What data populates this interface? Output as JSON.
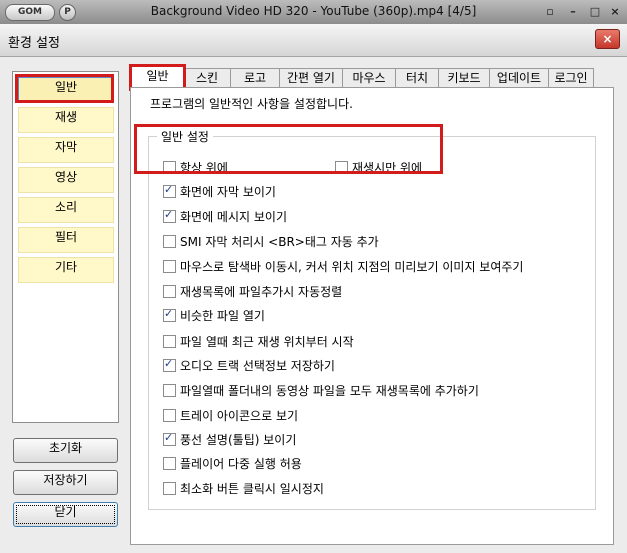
{
  "player": {
    "logo": "GOM",
    "p_badge": "P",
    "title": "Background Video HD 320 - YouTube (360p).mp4  [4/5]",
    "controls": {
      "pin": "▫",
      "minimize": "–",
      "maximize": "□",
      "close": "×"
    }
  },
  "dialog": {
    "title": "환경 설정",
    "close": "×"
  },
  "categories": [
    "일반",
    "재생",
    "자막",
    "영상",
    "소리",
    "필터",
    "기타"
  ],
  "selected_category": "일반",
  "side_buttons": {
    "reset": "초기화",
    "save": "저장하기",
    "close": "닫기"
  },
  "tabs": [
    "일반",
    "스킨",
    "로고",
    "간편 열기",
    "마우스",
    "터치",
    "키보드",
    "업데이트",
    "로그인"
  ],
  "active_tab": "일반",
  "description": "프로그램의 일반적인 사항을 설정합니다.",
  "group_label": "일반 설정",
  "options": [
    {
      "label": "항상 위에",
      "checked": false
    },
    {
      "label": "재생시만 위에",
      "checked": false
    },
    {
      "label": "화면에 자막 보이기",
      "checked": true
    },
    {
      "label": "화면에 메시지 보이기",
      "checked": true
    },
    {
      "label": "SMI 자막 처리시 <BR>태그 자동 추가",
      "checked": false
    },
    {
      "label": "마우스로 탐색바 이동시, 커서 위치 지점의 미리보기 이미지 보여주기",
      "checked": false
    },
    {
      "label": "재생목록에 파일추가시 자동정렬",
      "checked": false
    },
    {
      "label": "비슷한 파일 열기",
      "checked": true
    },
    {
      "label": "파일 열때 최근 재생 위치부터 시작",
      "checked": false
    },
    {
      "label": "오디오 트랙 선택정보 저장하기",
      "checked": true
    },
    {
      "label": "파일열때 폴더내의 동영상 파일을 모두 재생목록에 추가하기",
      "checked": false
    },
    {
      "label": "트레이 아이콘으로 보기",
      "checked": false
    },
    {
      "label": "풍선 설명(툴팁) 보이기",
      "checked": true
    },
    {
      "label": "플레이어 다중 실행 허용",
      "checked": false
    },
    {
      "label": "최소화 버튼 클릭시 일시정지",
      "checked": false
    }
  ],
  "highlight_color": "#d21c1c"
}
